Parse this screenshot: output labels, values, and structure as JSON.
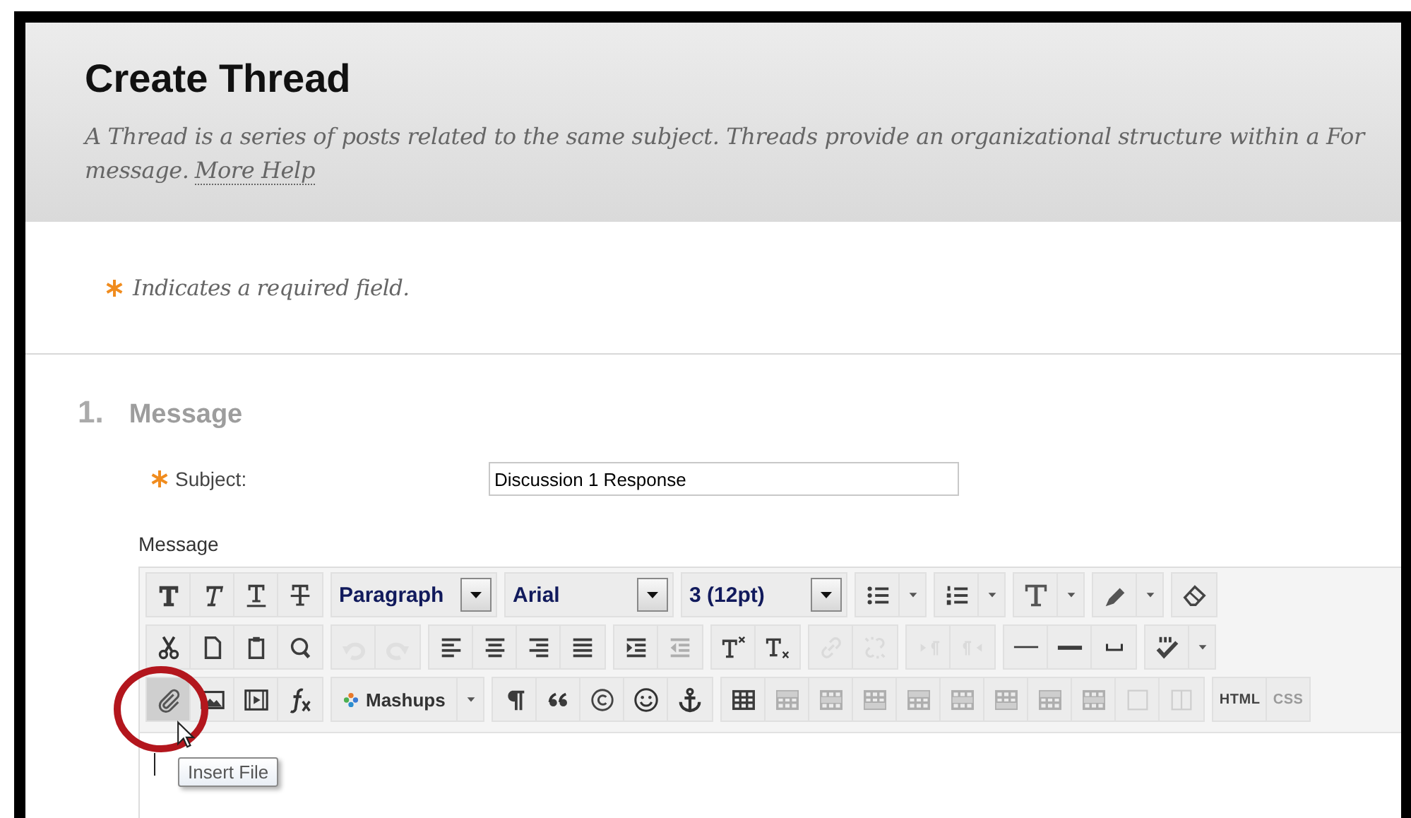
{
  "header": {
    "title": "Create Thread",
    "description": "A Thread is a series of posts related to the same subject. Threads provide an organizational structure within a For",
    "description_end": "message.",
    "help_link": "More Help"
  },
  "required_note": "Indicates a required field.",
  "section": {
    "number": "1.",
    "title": "Message"
  },
  "subject": {
    "label": "Subject:",
    "value": "Discussion 1 Response"
  },
  "message_label": "Message",
  "toolbar": {
    "rows": [
      [
        {
          "kind": "group",
          "buttons": [
            {
              "disabled": false,
              "hovered": false
            },
            {
              "disabled": false,
              "hovered": false
            },
            {
              "disabled": false,
              "hovered": false
            },
            {
              "disabled": false,
              "hovered": false
            }
          ]
        },
        {
          "kind": "select",
          "value": "Paragraph"
        },
        {
          "kind": "select",
          "value": "Arial"
        },
        {
          "kind": "select",
          "value": "3 (12pt)"
        },
        {
          "kind": "split",
          "disabled": false
        },
        {
          "kind": "split",
          "disabled": false
        },
        {
          "kind": "split",
          "disabled": false
        },
        {
          "kind": "split",
          "disabled": false
        },
        {
          "kind": "group",
          "buttons": [
            {
              "disabled": false,
              "hovered": false
            }
          ]
        }
      ],
      [
        {
          "kind": "group",
          "buttons": [
            {
              "disabled": false,
              "hovered": false
            },
            {
              "disabled": false,
              "hovered": false
            },
            {
              "disabled": false,
              "hovered": false
            },
            {
              "disabled": false,
              "hovered": false
            }
          ]
        },
        {
          "kind": "group",
          "buttons": [
            {
              "disabled": true,
              "hovered": false
            },
            {
              "disabled": true,
              "hovered": false
            }
          ]
        },
        {
          "kind": "group",
          "buttons": [
            {
              "disabled": false,
              "hovered": false
            },
            {
              "disabled": false,
              "hovered": false
            },
            {
              "disabled": false,
              "hovered": false
            },
            {
              "disabled": false,
              "hovered": false
            }
          ]
        },
        {
          "kind": "group",
          "buttons": [
            {
              "disabled": false,
              "hovered": false
            },
            {
              "disabled": true,
              "hovered": false
            }
          ]
        },
        {
          "kind": "group",
          "buttons": [
            {
              "disabled": false,
              "hovered": false
            },
            {
              "disabled": false,
              "hovered": false
            }
          ]
        },
        {
          "kind": "group",
          "buttons": [
            {
              "disabled": true,
              "hovered": false
            },
            {
              "disabled": true,
              "hovered": false
            }
          ]
        },
        {
          "kind": "group",
          "buttons": [
            {
              "disabled": true,
              "hovered": false
            },
            {
              "disabled": true,
              "hovered": false
            }
          ]
        },
        {
          "kind": "group",
          "buttons": [
            {
              "disabled": false,
              "hovered": false
            },
            {
              "disabled": false,
              "hovered": false
            },
            {
              "disabled": false,
              "hovered": false
            }
          ]
        },
        {
          "kind": "split",
          "disabled": false
        }
      ],
      [
        {
          "kind": "group",
          "buttons": [
            {
              "disabled": false,
              "hovered": true
            },
            {
              "disabled": false,
              "hovered": false
            },
            {
              "disabled": false,
              "hovered": false
            },
            {
              "disabled": false,
              "hovered": false
            }
          ]
        },
        {
          "kind": "menu",
          "label": "Mashups"
        },
        {
          "kind": "group",
          "buttons": [
            {
              "disabled": false,
              "hovered": false
            },
            {
              "disabled": false,
              "hovered": false
            },
            {
              "disabled": false,
              "hovered": false
            },
            {
              "disabled": false,
              "hovered": false
            },
            {
              "disabled": false,
              "hovered": false
            }
          ]
        },
        {
          "kind": "group",
          "buttons": [
            {
              "disabled": false,
              "hovered": false
            },
            {
              "disabled": true,
              "hovered": false
            },
            {
              "disabled": true,
              "hovered": false
            },
            {
              "disabled": true,
              "hovered": false
            },
            {
              "disabled": true,
              "hovered": false
            },
            {
              "disabled": true,
              "hovered": false
            },
            {
              "disabled": true,
              "hovered": false
            },
            {
              "disabled": true,
              "hovered": false
            },
            {
              "disabled": true,
              "hovered": false
            },
            {
              "disabled": true,
              "hovered": false
            },
            {
              "disabled": true,
              "hovered": false
            }
          ]
        },
        {
          "kind": "text_group",
          "buttons": [
            {
              "label": "HTML",
              "disabled": false
            },
            {
              "label": "CSS",
              "disabled": true
            }
          ]
        }
      ]
    ]
  },
  "tooltip": "Insert File"
}
